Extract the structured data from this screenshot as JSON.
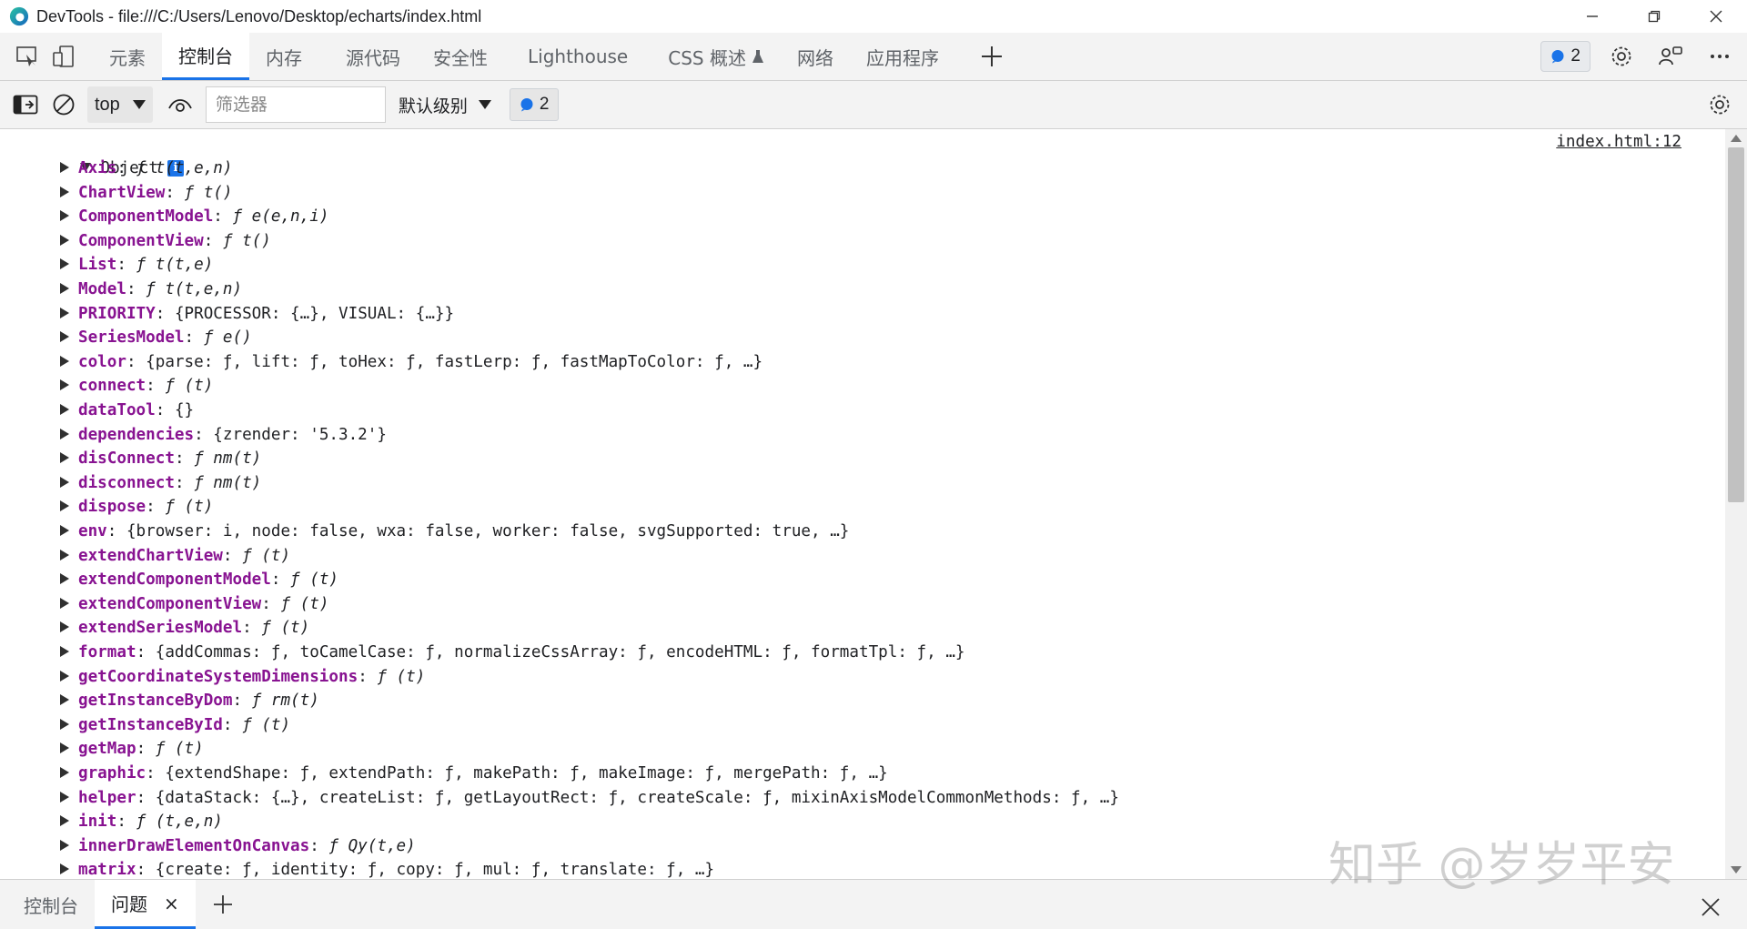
{
  "window": {
    "title": "DevTools - file:///C:/Users/Lenovo/Desktop/echarts/index.html"
  },
  "tabs": [
    {
      "label": "元素"
    },
    {
      "label": "控制台"
    },
    {
      "label": "内存"
    },
    {
      "label": "源代码"
    },
    {
      "label": "安全性"
    },
    {
      "label": "Lighthouse"
    },
    {
      "label": "CSS 概述"
    },
    {
      "label": "网络"
    },
    {
      "label": "应用程序"
    }
  ],
  "issues_badge": "2",
  "toolbar": {
    "context": "top",
    "filter_placeholder": "筛选器",
    "level": "默认级别",
    "messages_count": "2"
  },
  "console": {
    "object_label": "Object",
    "info_glyph": "i",
    "source_link": "index.html:12",
    "entries": [
      {
        "key": "Axis",
        "value": "ƒ t(t,e,n)"
      },
      {
        "key": "ChartView",
        "value": "ƒ t()"
      },
      {
        "key": "ComponentModel",
        "value": "ƒ e(e,n,i)"
      },
      {
        "key": "ComponentView",
        "value": "ƒ t()"
      },
      {
        "key": "List",
        "value": "ƒ t(t,e)"
      },
      {
        "key": "Model",
        "value": "ƒ t(t,e,n)"
      },
      {
        "key": "PRIORITY",
        "value": "{PROCESSOR: {…}, VISUAL: {…}}"
      },
      {
        "key": "SeriesModel",
        "value": "ƒ e()"
      },
      {
        "key": "color",
        "value": "{parse: ƒ, lift: ƒ, toHex: ƒ, fastLerp: ƒ, fastMapToColor: ƒ, …}"
      },
      {
        "key": "connect",
        "value": "ƒ (t)"
      },
      {
        "key": "dataTool",
        "value": "{}"
      },
      {
        "key": "dependencies",
        "value": "{zrender: '5.3.2'}"
      },
      {
        "key": "disConnect",
        "value": "ƒ nm(t)"
      },
      {
        "key": "disconnect",
        "value": "ƒ nm(t)"
      },
      {
        "key": "dispose",
        "value": "ƒ (t)"
      },
      {
        "key": "env",
        "value": "{browser: i, node: false, wxa: false, worker: false, svgSupported: true, …}"
      },
      {
        "key": "extendChartView",
        "value": "ƒ (t)"
      },
      {
        "key": "extendComponentModel",
        "value": "ƒ (t)"
      },
      {
        "key": "extendComponentView",
        "value": "ƒ (t)"
      },
      {
        "key": "extendSeriesModel",
        "value": "ƒ (t)"
      },
      {
        "key": "format",
        "value": "{addCommas: ƒ, toCamelCase: ƒ, normalizeCssArray: ƒ, encodeHTML: ƒ, formatTpl: ƒ, …}"
      },
      {
        "key": "getCoordinateSystemDimensions",
        "value": "ƒ (t)"
      },
      {
        "key": "getInstanceByDom",
        "value": "ƒ rm(t)"
      },
      {
        "key": "getInstanceById",
        "value": "ƒ (t)"
      },
      {
        "key": "getMap",
        "value": "ƒ (t)"
      },
      {
        "key": "graphic",
        "value": "{extendShape: ƒ, extendPath: ƒ, makePath: ƒ, makeImage: ƒ, mergePath: ƒ, …}"
      },
      {
        "key": "helper",
        "value": "{dataStack: {…}, createList: ƒ, getLayoutRect: ƒ, createScale: ƒ, mixinAxisModelCommonMethods: ƒ, …}"
      },
      {
        "key": "init",
        "value": "ƒ (t,e,n)"
      },
      {
        "key": "innerDrawElementOnCanvas",
        "value": "ƒ Qy(t,e)"
      },
      {
        "key": "matrix",
        "value": "{create: ƒ, identity: ƒ, copy: ƒ, mul: ƒ, translate: ƒ, …}"
      }
    ]
  },
  "drawer": {
    "tabs": [
      {
        "label": "控制台"
      },
      {
        "label": "问题"
      }
    ],
    "close_glyph": "×"
  },
  "watermark": "知乎 @岁岁平安"
}
